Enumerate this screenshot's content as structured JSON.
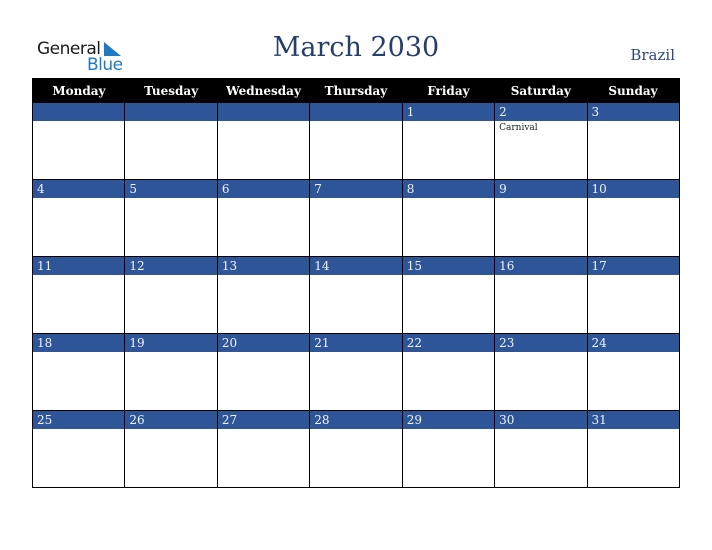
{
  "logo": {
    "line1": "General",
    "line2": "Blue"
  },
  "header": {
    "title": "March 2030",
    "country": "Brazil"
  },
  "colors": {
    "band": "#2e5597",
    "title": "#253f6a",
    "header_bg": "#000000",
    "logo_accent": "#1f7ac4"
  },
  "weekdays": [
    "Monday",
    "Tuesday",
    "Wednesday",
    "Thursday",
    "Friday",
    "Saturday",
    "Sunday"
  ],
  "weeks": [
    [
      {
        "day": ""
      },
      {
        "day": ""
      },
      {
        "day": ""
      },
      {
        "day": ""
      },
      {
        "day": "1"
      },
      {
        "day": "2",
        "event": "Carnival"
      },
      {
        "day": "3"
      }
    ],
    [
      {
        "day": "4"
      },
      {
        "day": "5"
      },
      {
        "day": "6"
      },
      {
        "day": "7"
      },
      {
        "day": "8"
      },
      {
        "day": "9"
      },
      {
        "day": "10"
      }
    ],
    [
      {
        "day": "11"
      },
      {
        "day": "12"
      },
      {
        "day": "13"
      },
      {
        "day": "14"
      },
      {
        "day": "15"
      },
      {
        "day": "16"
      },
      {
        "day": "17"
      }
    ],
    [
      {
        "day": "18"
      },
      {
        "day": "19"
      },
      {
        "day": "20"
      },
      {
        "day": "21"
      },
      {
        "day": "22"
      },
      {
        "day": "23"
      },
      {
        "day": "24"
      }
    ],
    [
      {
        "day": "25"
      },
      {
        "day": "26"
      },
      {
        "day": "27"
      },
      {
        "day": "28"
      },
      {
        "day": "29"
      },
      {
        "day": "30"
      },
      {
        "day": "31"
      }
    ]
  ]
}
